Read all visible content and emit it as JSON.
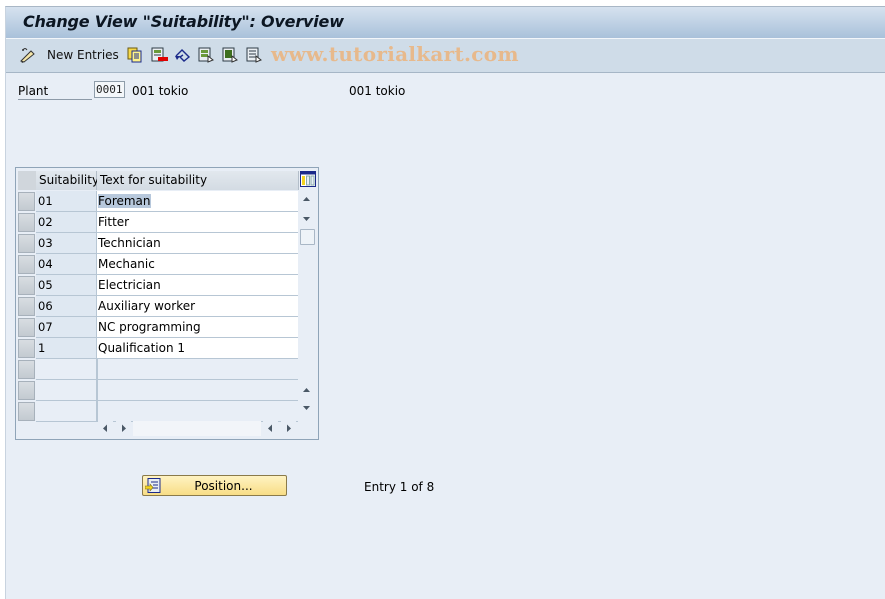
{
  "window": {
    "title": "Change View \"Suitability\": Overview"
  },
  "toolbar": {
    "items": [
      {
        "icon": "display-change-icon"
      },
      {
        "label": "New Entries"
      },
      {
        "icon": "copy-as-icon"
      },
      {
        "icon": "delete-icon"
      },
      {
        "icon": "undo-change-icon"
      },
      {
        "icon": "select-all-icon"
      },
      {
        "icon": "select-block-icon"
      },
      {
        "icon": "deselect-all-icon"
      }
    ],
    "new_entries_label": "New Entries",
    "watermark": "www.tutorialkart.com"
  },
  "header_fields": {
    "plant_label": "Plant",
    "plant_value": "0001",
    "plant_description": "001 tokio",
    "plant_description_right": "001 tokio"
  },
  "table": {
    "columns": [
      "Suitability",
      "Text for suitability"
    ],
    "rows": [
      {
        "suitability": "01",
        "text": "Foreman",
        "selected_text": true
      },
      {
        "suitability": "02",
        "text": "Fitter"
      },
      {
        "suitability": "03",
        "text": "Technician"
      },
      {
        "suitability": "04",
        "text": "Mechanic"
      },
      {
        "suitability": "05",
        "text": "Electrician"
      },
      {
        "suitability": "06",
        "text": "Auxiliary worker"
      },
      {
        "suitability": "07",
        "text": "NC programming"
      },
      {
        "suitability": "1",
        "text": "Qualification 1"
      }
    ],
    "empty_rows": 3
  },
  "footer": {
    "position_button": "Position...",
    "entry_info": "Entry 1 of 8"
  },
  "colors": {
    "titlebar": "#a9c1da",
    "toolbar": "#cfdce8",
    "background": "#e8eef6",
    "button": "#f8dd86",
    "watermark": "#e7b98c",
    "selection": "#b7c8dc"
  }
}
